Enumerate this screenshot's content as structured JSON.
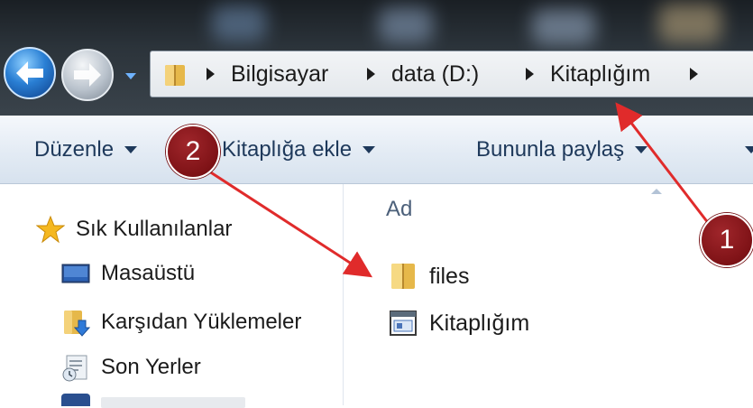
{
  "addressbar": {
    "breadcrumbs": [
      "Bilgisayar",
      "data (D:)",
      "Kitaplığım"
    ]
  },
  "toolbar": {
    "organize_label": "Düzenle",
    "include_library_label": "Kitaplığa ekle",
    "share_label": "Bununla paylaş"
  },
  "navpane": {
    "favorites_label": "Sık Kullanılanlar",
    "items": [
      "Masaüstü",
      "Karşıdan Yüklemeler",
      "Son Yerler"
    ]
  },
  "content": {
    "column_header": "Ad",
    "files": [
      {
        "name": "files",
        "icon": "folder-icon"
      },
      {
        "name": "Kitaplığım",
        "icon": "library-file-icon"
      }
    ]
  },
  "annotations": {
    "badge_1": "1",
    "badge_2": "2",
    "color": "#e02b2b"
  }
}
